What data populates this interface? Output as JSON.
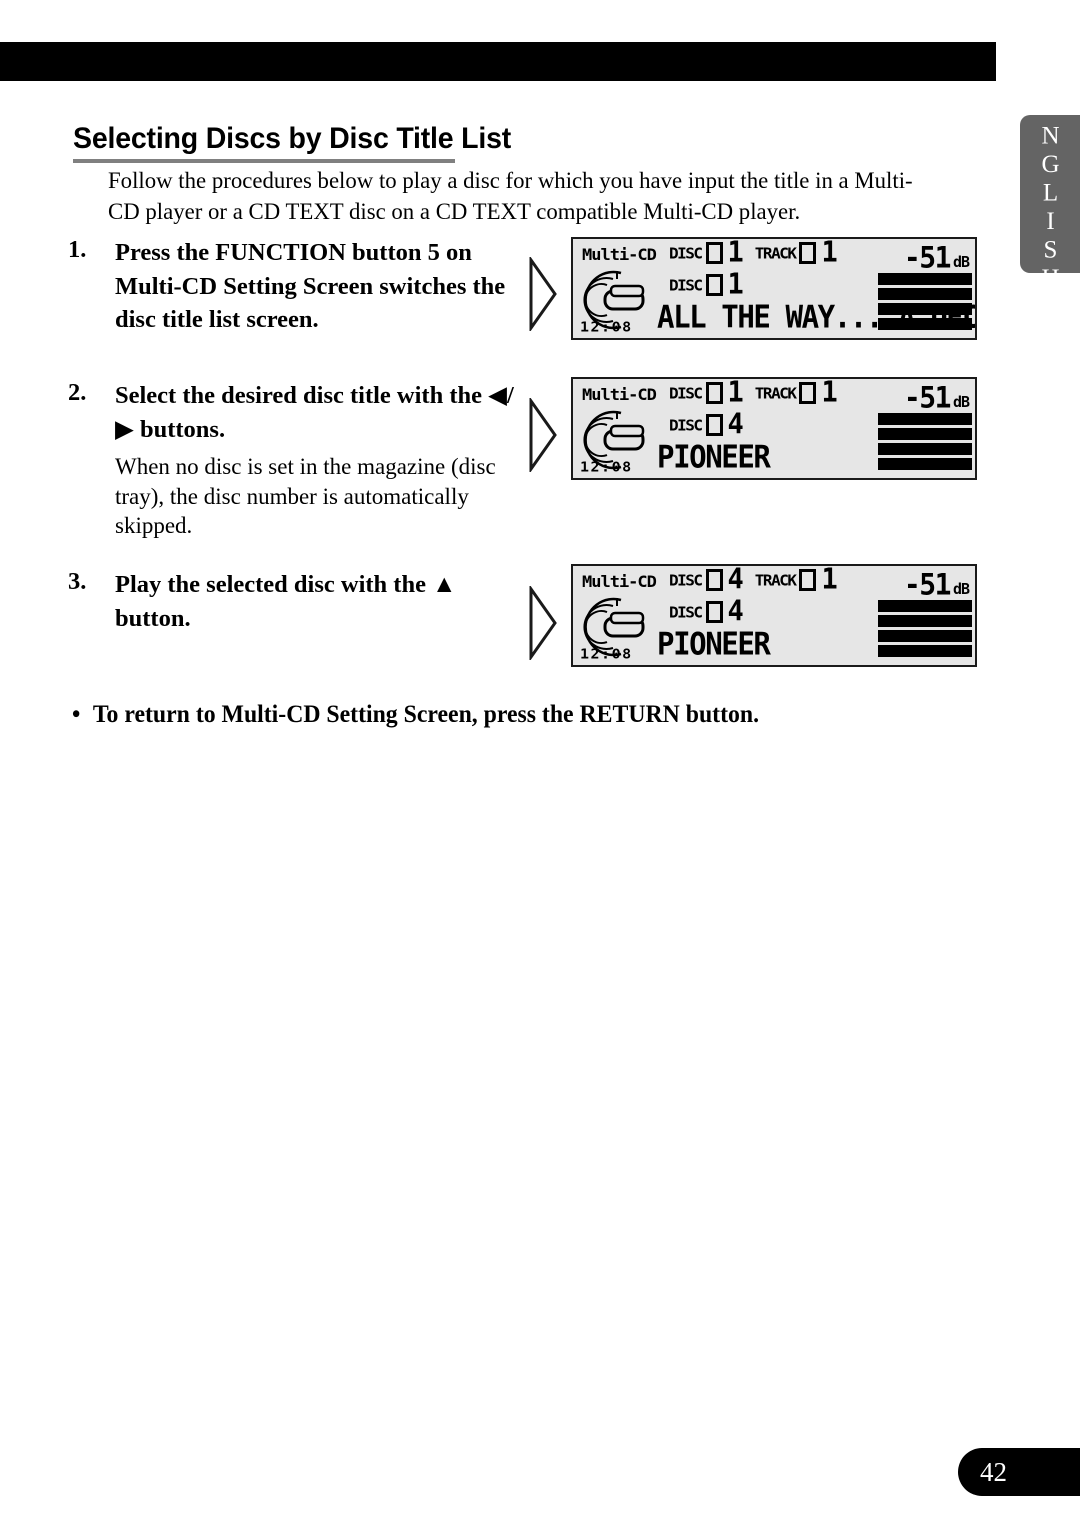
{
  "page": {
    "number": "42",
    "language_tab": "ENGLISH"
  },
  "heading": {
    "title": "Selecting Discs by Disc Title List"
  },
  "intro": {
    "text": "Follow the procedures below to play a disc for which you have input the title in a Multi-CD player or a CD TEXT disc on a CD TEXT compatible Multi-CD player."
  },
  "steps": [
    {
      "number": "1.",
      "title": "Press the FUNCTION button 5 on Multi-CD Setting Screen switches the disc title list screen.",
      "note": ""
    },
    {
      "number": "2.",
      "title": "Select the desired disc title with the ◀/▶ buttons.",
      "note": "When no disc is set in the magazine (disc tray), the disc number is automatically skipped."
    },
    {
      "number": "3.",
      "title": "Play the selected disc with the ▲ button.",
      "note": ""
    }
  ],
  "bullet_note": {
    "bullet": "•",
    "text": "To return to Multi-CD Setting Screen, press the RETURN button."
  },
  "displays": [
    {
      "source": "Multi-CD",
      "disc_label": "DISC",
      "disc_number": "1",
      "track_label": "TRACK",
      "track_number": "1",
      "list_disc_label": "DISC",
      "list_disc_number": "1",
      "title": "ALL THE WAY... A DECA",
      "clock": "12:08",
      "level_value": "-51",
      "level_unit": "dB",
      "bar_count": 4
    },
    {
      "source": "Multi-CD",
      "disc_label": "DISC",
      "disc_number": "1",
      "track_label": "TRACK",
      "track_number": "1",
      "list_disc_label": "DISC",
      "list_disc_number": "4",
      "title": "PIONEER",
      "clock": "12:08",
      "level_value": "-51",
      "level_unit": "dB",
      "bar_count": 4
    },
    {
      "source": "Multi-CD",
      "disc_label": "DISC",
      "disc_number": "4",
      "track_label": "TRACK",
      "track_number": "1",
      "list_disc_label": "DISC",
      "list_disc_number": "4",
      "title": "PIONEER",
      "clock": "12:08",
      "level_value": "-51",
      "level_unit": "dB",
      "bar_count": 4
    }
  ],
  "colors": {
    "bar_black": "#000000",
    "tab_gray": "#646464",
    "rule_gray": "#808080",
    "lcd_bg": "#e6e6e6"
  }
}
